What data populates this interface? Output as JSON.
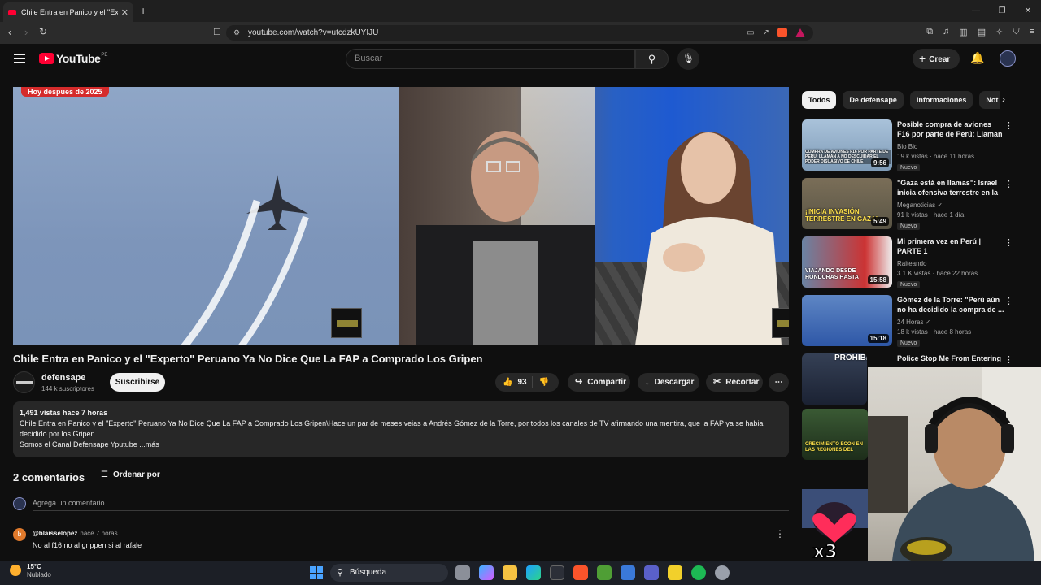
{
  "browser": {
    "tab_title": "Chile Entra en Panico y el \"Experto\" Peruano Ya No Dice Que La FAP a Comprado Los Gripen",
    "url": "youtube.com/watch?v=utcdzkUYIJU"
  },
  "youtube": {
    "logo_text": "YouTube",
    "country_code": "PE",
    "search_placeholder": "Buscar",
    "create_label": "Crear"
  },
  "player": {
    "banner_text": "Hoy despues de 2025"
  },
  "video": {
    "title": "Chile Entra en Panico y el \"Experto\" Peruano Ya No Dice Que La FAP a Comprado Los Gripen",
    "channel": "defensape",
    "subscribers": "144 k suscriptores",
    "subscribe_label": "Suscribirse",
    "likes": "93",
    "share_label": "Compartir",
    "download_label": "Descargar",
    "clip_label": "Recortar",
    "description": {
      "meta": "1,491 vistas  hace 7 horas",
      "line1": "Chile Entra en Panico y el \"Experto\" Peruano Ya No Dice Que La FAP a Comprado Los Gripen\\Hace un par de meses veias a Andrés Gómez de la Torre, por todos los canales de TV afirmando una mentira, que la FAP ya se habia decidido por los Gripen.",
      "line2": "Somos el Canal Defensape Yputube ...más"
    }
  },
  "comments": {
    "count_label": "2 comentarios",
    "sort_label": "Ordenar por",
    "add_placeholder": "Agrega un comentario...",
    "items": [
      {
        "initial": "b",
        "user": "@blaisselopez",
        "time": "hace 7 horas",
        "text": "No al f16 no al grippen si al rafale"
      }
    ]
  },
  "sidebar": {
    "chips": [
      "Todos",
      "De defensape",
      "Informaciones",
      "Not"
    ],
    "recommendations": [
      {
        "title": "Posible compra de aviones F16 por parte de Perú: Llaman a n...",
        "channel": "Bio Bio",
        "stats": "19 k vistas · hace 11 horas",
        "badge": "Nuevo",
        "duration": "9:56",
        "thumb_text": "COMPRA DE AVIONES F16 POR PARTE DE PERÚ: LLAMAN A NO DESCUIDAR EL PODER DISUASIVO DE CHILE"
      },
      {
        "title": "\"Gaza está en llamas\": Israel inicia ofensiva terrestre en la ...",
        "channel": "Meganoticias ✓",
        "stats": "91 k vistas · hace 1 día",
        "badge": "Nuevo",
        "duration": "5:49",
        "thumb_text": "¡INICIA INVASIÓN TERRESTRE EN GAZA!"
      },
      {
        "title": "Mi primera vez en Perú | PARTE 1",
        "channel": "Raiteando",
        "stats": "3.1 K vistas · hace 22 horas",
        "badge": "Nuevo",
        "duration": "15:58",
        "thumb_text": "VIAJANDO DESDE HONDURAS HASTA"
      },
      {
        "title": "Gómez de la Torre: \"Perú aún no ha decidido la compra de ...",
        "channel": "24 Horas ✓",
        "stats": "18 k vistas · hace 8 horas",
        "badge": "Nuevo",
        "duration": "15:18",
        "thumb_text": ""
      },
      {
        "title": "Police Stop Me From Entering",
        "channel": "",
        "stats": "",
        "badge": "",
        "duration": "",
        "thumb_text": "PROHIBITED"
      },
      {
        "title": "",
        "channel": "",
        "stats": "",
        "badge": "",
        "duration": "",
        "thumb_text": "CRECIMIENTO ECON EN LAS REGIONES DEL"
      }
    ]
  },
  "overlay": {
    "sticker_text": "x3"
  },
  "taskbar": {
    "temperature": "15°C",
    "weather": "Nublado",
    "search_label": "Búsqueda"
  },
  "colors": {
    "accent_red": "#ff0033",
    "background": "#0f0f0f",
    "chip_bg": "#272727"
  }
}
